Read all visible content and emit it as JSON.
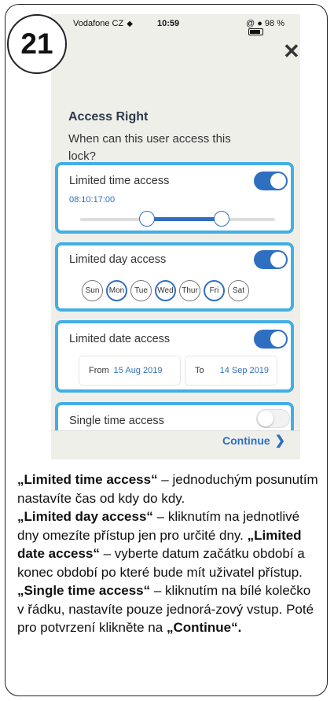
{
  "step_number": "21",
  "statusbar": {
    "carrier": "Vodafone CZ",
    "time": "10:59",
    "right": "@ ● 98 %"
  },
  "header": {
    "title": "Access Right",
    "question": "When can this user access this lock?"
  },
  "cards": {
    "time": {
      "label": "Limited time access",
      "enabled": true,
      "value": "08:10:17:00",
      "range_start_fraction": 0.34,
      "range_end_fraction": 0.71
    },
    "day": {
      "label": "Limited day access",
      "enabled": true,
      "days": [
        {
          "label": "Sun",
          "selected": false
        },
        {
          "label": "Mon",
          "selected": true
        },
        {
          "label": "Tue",
          "selected": false
        },
        {
          "label": "Wed",
          "selected": true
        },
        {
          "label": "Thur",
          "selected": false
        },
        {
          "label": "Fri",
          "selected": true
        },
        {
          "label": "Sat",
          "selected": false
        }
      ]
    },
    "date": {
      "label": "Limited date access",
      "enabled": true,
      "from_label": "From",
      "from_value": "15 Aug 2019",
      "to_label": "To",
      "to_value": "14 Sep 2019"
    },
    "single": {
      "label": "Single time access",
      "enabled": false
    }
  },
  "continue_label": "Continue",
  "description": {
    "p1_bold": "„Limited time access“",
    "p1_text": " – jednoduchým posunutím nastavíte čas od kdy do kdy.",
    "p2_bold": "„Limited day access“",
    "p2_text": " – kliknutím na jednotlivé dny omezíte přístup jen pro určité dny. ",
    "p3_bold": "„Limited date access“",
    "p3_text": " – vyberte datum začátku období a konec období po které bude mít uživatel přístup.",
    "p4_bold": "„Single time access“",
    "p4_text": " – kliknutím na bílé kolečko v řádku, nastavíte pouze jednorá-zový vstup. Poté pro potvrzení klikněte na ",
    "p5_bold": "„Continue“."
  }
}
